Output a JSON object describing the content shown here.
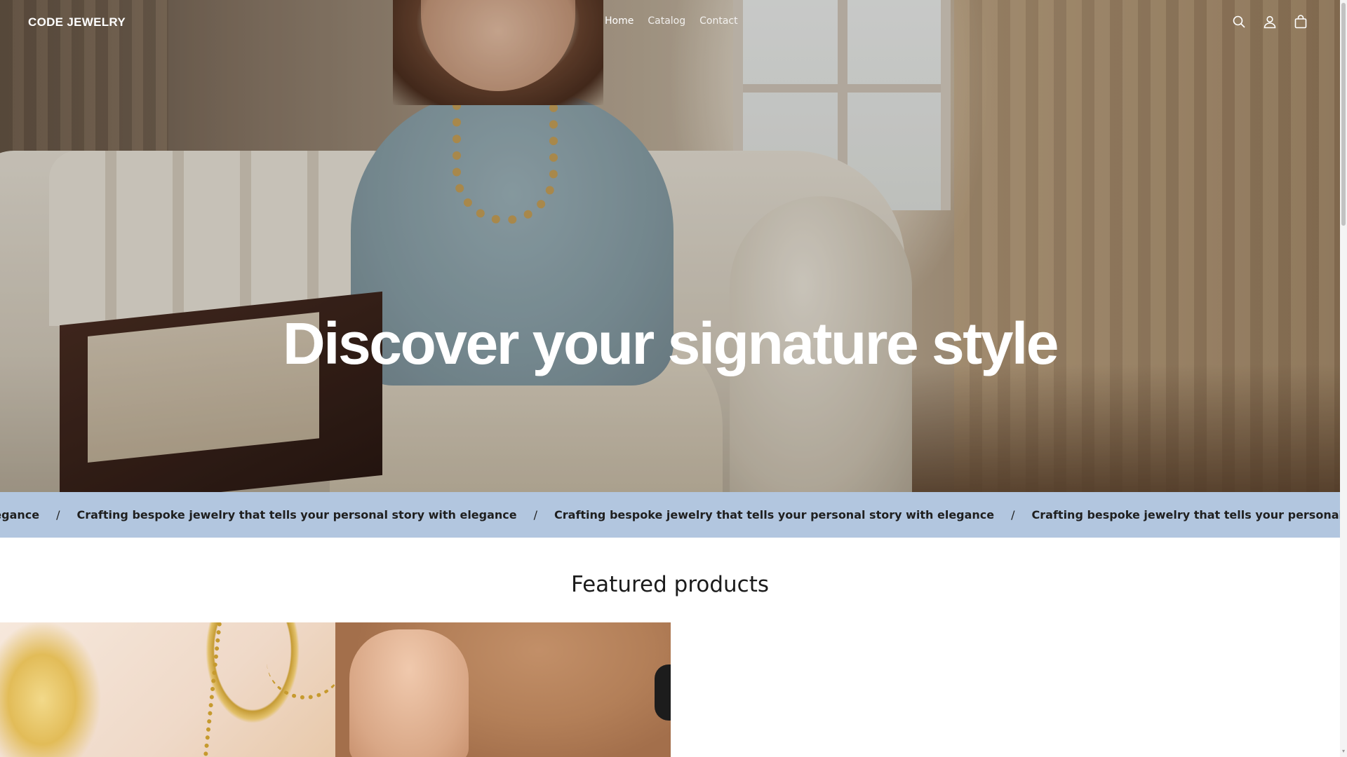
{
  "header": {
    "logo": "CODE JEWELRY",
    "nav": [
      {
        "label": "Home"
      },
      {
        "label": "Catalog"
      },
      {
        "label": "Contact"
      }
    ],
    "icons": [
      "search-icon",
      "account-icon",
      "cart-icon"
    ]
  },
  "hero": {
    "title": "Discover your signature style"
  },
  "marquee": {
    "items": [
      "t tells your personal story with elegance",
      "Crafting bespoke jewelry that tells your personal story with elegance",
      "Crafting bespoke jewelry that tells your personal story with elegance",
      "Crafting bespoke jewelry that tells your personal story with elegance"
    ],
    "separator": "/",
    "background": "#b2c6df"
  },
  "featured": {
    "title": "Featured products"
  }
}
